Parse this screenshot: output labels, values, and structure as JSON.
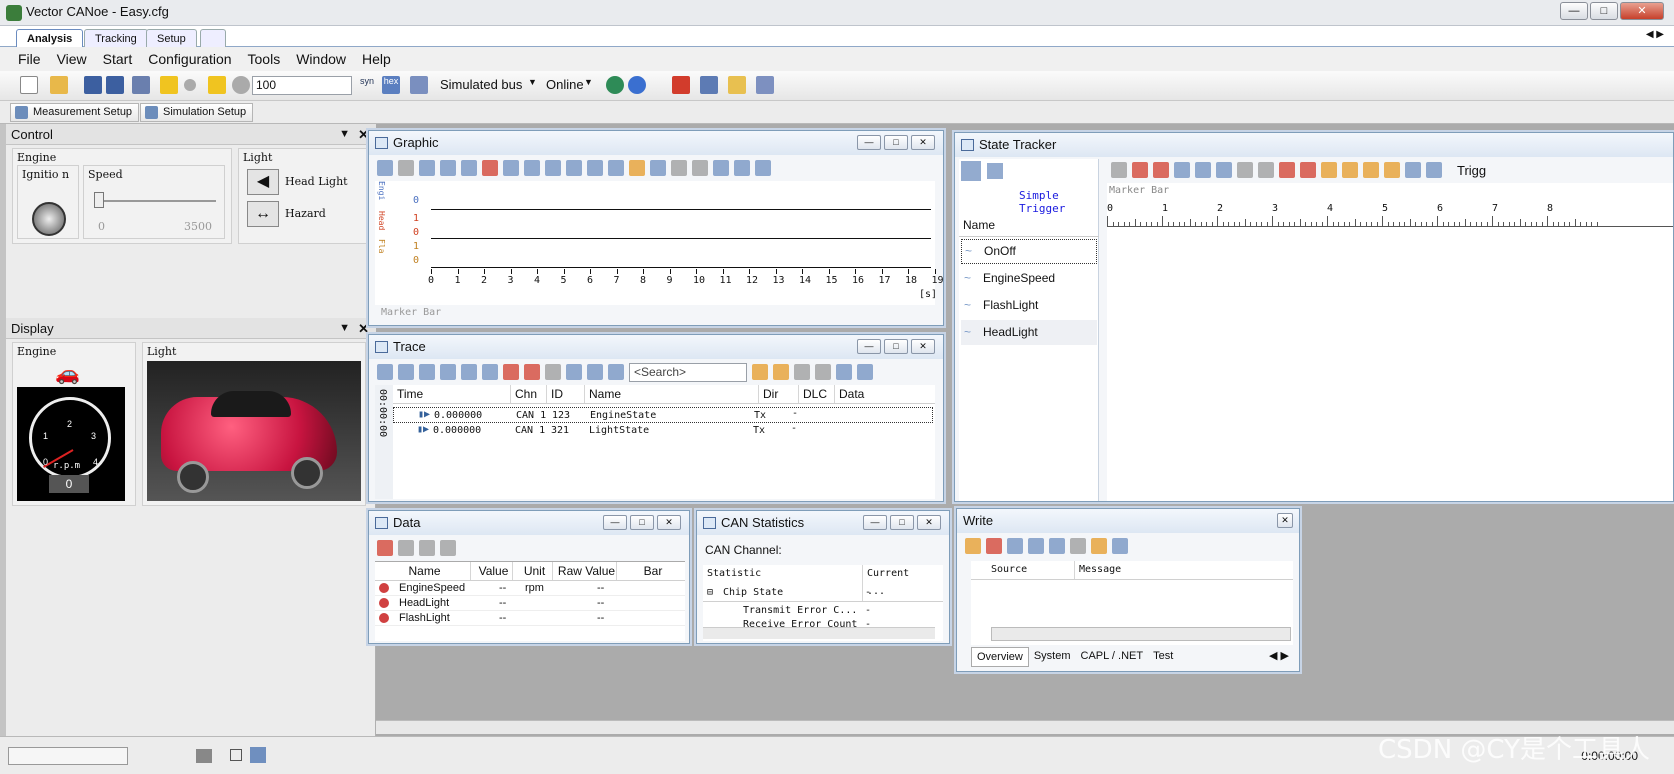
{
  "window": {
    "title": "Vector CANoe  - Easy.cfg"
  },
  "workspace_tabs": [
    "Analysis",
    "Tracking",
    "Setup"
  ],
  "menu": [
    "File",
    "View",
    "Start",
    "Configuration",
    "Tools",
    "Window",
    "Help"
  ],
  "toolbar": {
    "timer_value": "100",
    "syn": "syn",
    "hex": "hex",
    "simulated_bus": "Simulated bus",
    "online": "Online"
  },
  "setup_buttons": [
    "Measurement Setup",
    "Simulation Setup"
  ],
  "control": {
    "title": "Control",
    "engine_label": "Engine",
    "ignition_label": "Ignitio n",
    "speed_label": "Speed",
    "speed_min": "0",
    "speed_max": "3500",
    "light_label": "Light",
    "head_light_label": "Head Light",
    "hazard_label": "Hazard"
  },
  "display": {
    "title": "Display",
    "engine_label": "Engine",
    "light_label": "Light",
    "gauge_unit": "r.p.m",
    "gauge_ticks": [
      "0",
      "1",
      "2",
      "3",
      "4"
    ],
    "gauge_value": "0"
  },
  "graphic": {
    "title": "Graphic",
    "x_ticks": [
      "0",
      "1",
      "2",
      "3",
      "4",
      "5",
      "6",
      "7",
      "8",
      "9",
      "10",
      "11",
      "12",
      "13",
      "14",
      "15",
      "16",
      "17",
      "18",
      "19"
    ],
    "x_unit": "[s]",
    "marker_bar": "Marker Bar",
    "y_labels": [
      "0",
      "1",
      "0",
      "1",
      "0"
    ],
    "signals": [
      "Engi",
      "Head",
      "Fla"
    ]
  },
  "trace": {
    "title": "Trace",
    "search_placeholder": "<Search>",
    "columns": [
      "Time",
      "Chn",
      "ID",
      "Name",
      "Dir",
      "DLC",
      "Data"
    ],
    "side_label": "00:00:00",
    "rows": [
      {
        "time": "0.000000",
        "chn": "CAN 1",
        "id": "123",
        "name": "EngineState",
        "dir": "Tx",
        "dlc": "-"
      },
      {
        "time": "0.000000",
        "chn": "CAN 1",
        "id": "321",
        "name": "LightState",
        "dir": "Tx",
        "dlc": "-"
      }
    ]
  },
  "state_tracker": {
    "title": "State Tracker",
    "trigger": "Simple Trigger",
    "trig_label": "Trigg",
    "marker_bar": "Marker Bar",
    "name_header": "Name",
    "signals": [
      "OnOff",
      "EngineSpeed",
      "FlashLight",
      "HeadLight"
    ],
    "ticks": [
      "0",
      "1",
      "2",
      "3",
      "4",
      "5",
      "6",
      "7",
      "8"
    ]
  },
  "data_window": {
    "title": "Data",
    "columns": [
      "Name",
      "Value",
      "Unit",
      "Raw Value",
      "Bar"
    ],
    "rows": [
      {
        "name": "EngineSpeed",
        "value": "--",
        "unit": "rpm",
        "raw": "--"
      },
      {
        "name": "HeadLight",
        "value": "--",
        "unit": "",
        "raw": "--"
      },
      {
        "name": "FlashLight",
        "value": "--",
        "unit": "",
        "raw": "--"
      }
    ]
  },
  "can_statistics": {
    "title": "CAN Statistics",
    "channel_label": "CAN Channel:",
    "columns": [
      "Statistic",
      "Current ..."
    ],
    "rows": [
      {
        "stat": "Chip State",
        "val": "-"
      },
      {
        "stat": "Transmit Error C...",
        "val": "-"
      },
      {
        "stat": "Receive Error Count",
        "val": "-"
      }
    ]
  },
  "write": {
    "title": "Write",
    "columns": [
      "Source",
      "Message"
    ],
    "tabs": [
      "Overview",
      "System",
      "CAPL / .NET",
      "Test"
    ]
  },
  "status": {
    "time": "0:00:00:00"
  },
  "watermark": "CSDN @CY是个工具人"
}
